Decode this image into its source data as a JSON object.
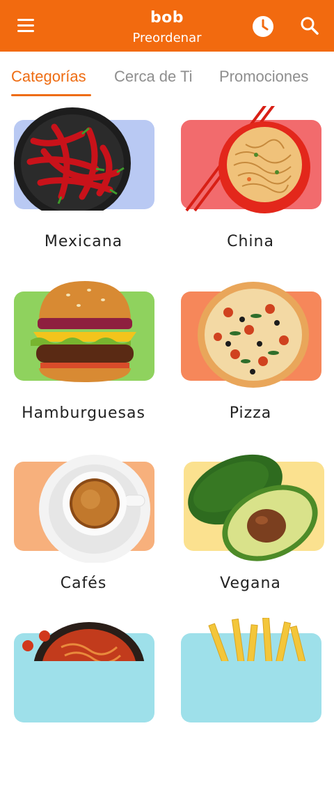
{
  "header": {
    "brand": "bob",
    "subtitle": "Preordenar",
    "icons": {
      "menu": "menu-icon",
      "clock": "clock-icon",
      "search": "search-icon"
    },
    "color": "#f26a0f"
  },
  "tabs": [
    {
      "label": "Categorías",
      "active": true
    },
    {
      "label": "Cerca de Ti",
      "active": false
    },
    {
      "label": "Promociones",
      "active": false
    }
  ],
  "categories": [
    {
      "label": "Mexicana",
      "image": "chili-peppers",
      "bg": "#b9c9f3"
    },
    {
      "label": "China",
      "image": "noodle-bowl",
      "bg": "#f26b6d"
    },
    {
      "label": "Hamburguesas",
      "image": "burger",
      "bg": "#8fd25e"
    },
    {
      "label": "Pizza",
      "image": "pizza",
      "bg": "#f6875a"
    },
    {
      "label": "Cafés",
      "image": "coffee-cup",
      "bg": "#f7b07c"
    },
    {
      "label": "Vegana",
      "image": "avocado",
      "bg": "#fbe18f"
    },
    {
      "label": "",
      "image": "pasta",
      "bg": "#9ee0ea"
    },
    {
      "label": "",
      "image": "fries",
      "bg": "#9ee0ea"
    }
  ],
  "accent": "#ee6c12"
}
